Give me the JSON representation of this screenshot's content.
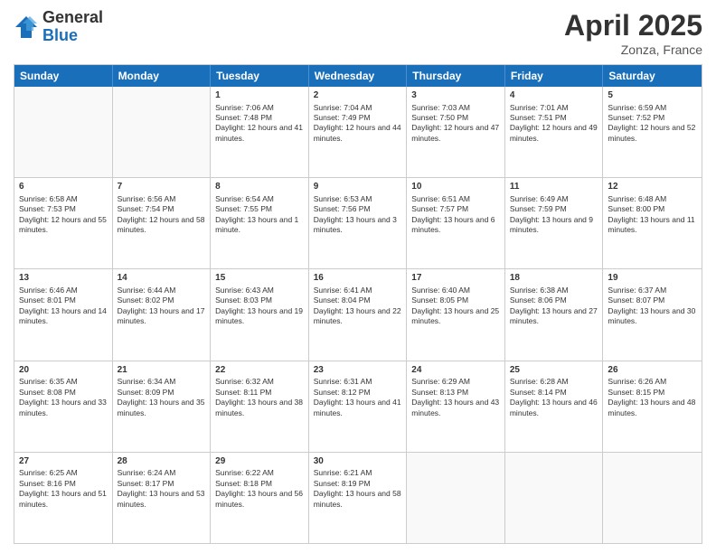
{
  "logo": {
    "general": "General",
    "blue": "Blue"
  },
  "title": {
    "month": "April 2025",
    "location": "Zonza, France"
  },
  "weekdays": [
    "Sunday",
    "Monday",
    "Tuesday",
    "Wednesday",
    "Thursday",
    "Friday",
    "Saturday"
  ],
  "rows": [
    [
      {
        "day": "",
        "sunrise": "",
        "sunset": "",
        "daylight": "",
        "empty": true
      },
      {
        "day": "",
        "sunrise": "",
        "sunset": "",
        "daylight": "",
        "empty": true
      },
      {
        "day": "1",
        "sunrise": "Sunrise: 7:06 AM",
        "sunset": "Sunset: 7:48 PM",
        "daylight": "Daylight: 12 hours and 41 minutes."
      },
      {
        "day": "2",
        "sunrise": "Sunrise: 7:04 AM",
        "sunset": "Sunset: 7:49 PM",
        "daylight": "Daylight: 12 hours and 44 minutes."
      },
      {
        "day": "3",
        "sunrise": "Sunrise: 7:03 AM",
        "sunset": "Sunset: 7:50 PM",
        "daylight": "Daylight: 12 hours and 47 minutes."
      },
      {
        "day": "4",
        "sunrise": "Sunrise: 7:01 AM",
        "sunset": "Sunset: 7:51 PM",
        "daylight": "Daylight: 12 hours and 49 minutes."
      },
      {
        "day": "5",
        "sunrise": "Sunrise: 6:59 AM",
        "sunset": "Sunset: 7:52 PM",
        "daylight": "Daylight: 12 hours and 52 minutes."
      }
    ],
    [
      {
        "day": "6",
        "sunrise": "Sunrise: 6:58 AM",
        "sunset": "Sunset: 7:53 PM",
        "daylight": "Daylight: 12 hours and 55 minutes."
      },
      {
        "day": "7",
        "sunrise": "Sunrise: 6:56 AM",
        "sunset": "Sunset: 7:54 PM",
        "daylight": "Daylight: 12 hours and 58 minutes."
      },
      {
        "day": "8",
        "sunrise": "Sunrise: 6:54 AM",
        "sunset": "Sunset: 7:55 PM",
        "daylight": "Daylight: 13 hours and 1 minute."
      },
      {
        "day": "9",
        "sunrise": "Sunrise: 6:53 AM",
        "sunset": "Sunset: 7:56 PM",
        "daylight": "Daylight: 13 hours and 3 minutes."
      },
      {
        "day": "10",
        "sunrise": "Sunrise: 6:51 AM",
        "sunset": "Sunset: 7:57 PM",
        "daylight": "Daylight: 13 hours and 6 minutes."
      },
      {
        "day": "11",
        "sunrise": "Sunrise: 6:49 AM",
        "sunset": "Sunset: 7:59 PM",
        "daylight": "Daylight: 13 hours and 9 minutes."
      },
      {
        "day": "12",
        "sunrise": "Sunrise: 6:48 AM",
        "sunset": "Sunset: 8:00 PM",
        "daylight": "Daylight: 13 hours and 11 minutes."
      }
    ],
    [
      {
        "day": "13",
        "sunrise": "Sunrise: 6:46 AM",
        "sunset": "Sunset: 8:01 PM",
        "daylight": "Daylight: 13 hours and 14 minutes."
      },
      {
        "day": "14",
        "sunrise": "Sunrise: 6:44 AM",
        "sunset": "Sunset: 8:02 PM",
        "daylight": "Daylight: 13 hours and 17 minutes."
      },
      {
        "day": "15",
        "sunrise": "Sunrise: 6:43 AM",
        "sunset": "Sunset: 8:03 PM",
        "daylight": "Daylight: 13 hours and 19 minutes."
      },
      {
        "day": "16",
        "sunrise": "Sunrise: 6:41 AM",
        "sunset": "Sunset: 8:04 PM",
        "daylight": "Daylight: 13 hours and 22 minutes."
      },
      {
        "day": "17",
        "sunrise": "Sunrise: 6:40 AM",
        "sunset": "Sunset: 8:05 PM",
        "daylight": "Daylight: 13 hours and 25 minutes."
      },
      {
        "day": "18",
        "sunrise": "Sunrise: 6:38 AM",
        "sunset": "Sunset: 8:06 PM",
        "daylight": "Daylight: 13 hours and 27 minutes."
      },
      {
        "day": "19",
        "sunrise": "Sunrise: 6:37 AM",
        "sunset": "Sunset: 8:07 PM",
        "daylight": "Daylight: 13 hours and 30 minutes."
      }
    ],
    [
      {
        "day": "20",
        "sunrise": "Sunrise: 6:35 AM",
        "sunset": "Sunset: 8:08 PM",
        "daylight": "Daylight: 13 hours and 33 minutes."
      },
      {
        "day": "21",
        "sunrise": "Sunrise: 6:34 AM",
        "sunset": "Sunset: 8:09 PM",
        "daylight": "Daylight: 13 hours and 35 minutes."
      },
      {
        "day": "22",
        "sunrise": "Sunrise: 6:32 AM",
        "sunset": "Sunset: 8:11 PM",
        "daylight": "Daylight: 13 hours and 38 minutes."
      },
      {
        "day": "23",
        "sunrise": "Sunrise: 6:31 AM",
        "sunset": "Sunset: 8:12 PM",
        "daylight": "Daylight: 13 hours and 41 minutes."
      },
      {
        "day": "24",
        "sunrise": "Sunrise: 6:29 AM",
        "sunset": "Sunset: 8:13 PM",
        "daylight": "Daylight: 13 hours and 43 minutes."
      },
      {
        "day": "25",
        "sunrise": "Sunrise: 6:28 AM",
        "sunset": "Sunset: 8:14 PM",
        "daylight": "Daylight: 13 hours and 46 minutes."
      },
      {
        "day": "26",
        "sunrise": "Sunrise: 6:26 AM",
        "sunset": "Sunset: 8:15 PM",
        "daylight": "Daylight: 13 hours and 48 minutes."
      }
    ],
    [
      {
        "day": "27",
        "sunrise": "Sunrise: 6:25 AM",
        "sunset": "Sunset: 8:16 PM",
        "daylight": "Daylight: 13 hours and 51 minutes."
      },
      {
        "day": "28",
        "sunrise": "Sunrise: 6:24 AM",
        "sunset": "Sunset: 8:17 PM",
        "daylight": "Daylight: 13 hours and 53 minutes."
      },
      {
        "day": "29",
        "sunrise": "Sunrise: 6:22 AM",
        "sunset": "Sunset: 8:18 PM",
        "daylight": "Daylight: 13 hours and 56 minutes."
      },
      {
        "day": "30",
        "sunrise": "Sunrise: 6:21 AM",
        "sunset": "Sunset: 8:19 PM",
        "daylight": "Daylight: 13 hours and 58 minutes."
      },
      {
        "day": "",
        "sunrise": "",
        "sunset": "",
        "daylight": "",
        "empty": true
      },
      {
        "day": "",
        "sunrise": "",
        "sunset": "",
        "daylight": "",
        "empty": true
      },
      {
        "day": "",
        "sunrise": "",
        "sunset": "",
        "daylight": "",
        "empty": true
      }
    ]
  ]
}
